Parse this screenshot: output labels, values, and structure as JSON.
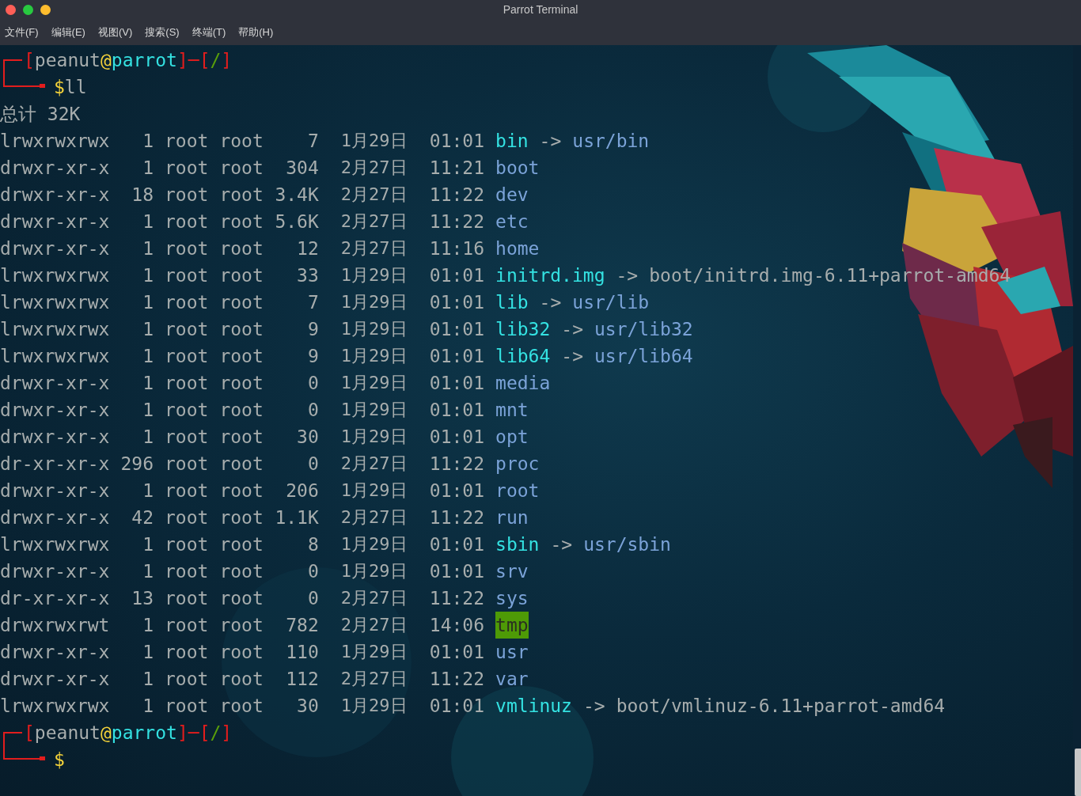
{
  "window": {
    "title": "Parrot Terminal"
  },
  "menu": [
    "文件(F)",
    "编辑(E)",
    "视图(V)",
    "搜索(S)",
    "终端(T)",
    "帮助(H)"
  ],
  "terminal": {
    "blocks": [
      {
        "kind": "prompt",
        "segments": [
          {
            "text": "[",
            "kind": "bracket"
          },
          {
            "text": "peanut",
            "kind": "user"
          },
          {
            "text": "@",
            "kind": "at"
          },
          {
            "text": "parrot",
            "kind": "host"
          },
          {
            "text": "]",
            "kind": "bracket"
          },
          {
            "text": "─",
            "kind": "bracket"
          },
          {
            "text": "[",
            "kind": "bracket"
          },
          {
            "text": "/",
            "kind": "path"
          },
          {
            "text": "]",
            "kind": "bracket"
          }
        ],
        "symbol": "$",
        "command": "ll"
      },
      {
        "kind": "total",
        "text": "总计 32K"
      },
      {
        "kind": "entry",
        "perms": "lrwxrwxrwx",
        "links": "1",
        "owner": "root",
        "group": "root",
        "size": "7",
        "date": "1月29日",
        "time": "01:01",
        "name": {
          "text": "bin",
          "kind": "link"
        },
        "arrow": "->",
        "target": {
          "text": "usr/bin",
          "kind": "dir"
        }
      },
      {
        "kind": "entry",
        "perms": "drwxr-xr-x",
        "links": "1",
        "owner": "root",
        "group": "root",
        "size": "304",
        "date": "2月27日",
        "time": "11:21",
        "name": {
          "text": "boot",
          "kind": "dir"
        }
      },
      {
        "kind": "entry",
        "perms": "drwxr-xr-x",
        "links": "18",
        "owner": "root",
        "group": "root",
        "size": "3.4K",
        "date": "2月27日",
        "time": "11:22",
        "name": {
          "text": "dev",
          "kind": "dir"
        }
      },
      {
        "kind": "entry",
        "perms": "drwxr-xr-x",
        "links": "1",
        "owner": "root",
        "group": "root",
        "size": "5.6K",
        "date": "2月27日",
        "time": "11:22",
        "name": {
          "text": "etc",
          "kind": "dir"
        }
      },
      {
        "kind": "entry",
        "perms": "drwxr-xr-x",
        "links": "1",
        "owner": "root",
        "group": "root",
        "size": "12",
        "date": "2月27日",
        "time": "11:16",
        "name": {
          "text": "home",
          "kind": "dir"
        }
      },
      {
        "kind": "entry",
        "perms": "lrwxrwxrwx",
        "links": "1",
        "owner": "root",
        "group": "root",
        "size": "33",
        "date": "1月29日",
        "time": "01:01",
        "name": {
          "text": "initrd.img",
          "kind": "link"
        },
        "arrow": "->",
        "target": {
          "text": "boot/initrd.img-6.11+parrot-amd64",
          "kind": "file"
        }
      },
      {
        "kind": "entry",
        "perms": "lrwxrwxrwx",
        "links": "1",
        "owner": "root",
        "group": "root",
        "size": "7",
        "date": "1月29日",
        "time": "01:01",
        "name": {
          "text": "lib",
          "kind": "link"
        },
        "arrow": "->",
        "target": {
          "text": "usr/lib",
          "kind": "dir"
        }
      },
      {
        "kind": "entry",
        "perms": "lrwxrwxrwx",
        "links": "1",
        "owner": "root",
        "group": "root",
        "size": "9",
        "date": "1月29日",
        "time": "01:01",
        "name": {
          "text": "lib32",
          "kind": "link"
        },
        "arrow": "->",
        "target": {
          "text": "usr/lib32",
          "kind": "dir"
        }
      },
      {
        "kind": "entry",
        "perms": "lrwxrwxrwx",
        "links": "1",
        "owner": "root",
        "group": "root",
        "size": "9",
        "date": "1月29日",
        "time": "01:01",
        "name": {
          "text": "lib64",
          "kind": "link"
        },
        "arrow": "->",
        "target": {
          "text": "usr/lib64",
          "kind": "dir"
        }
      },
      {
        "kind": "entry",
        "perms": "drwxr-xr-x",
        "links": "1",
        "owner": "root",
        "group": "root",
        "size": "0",
        "date": "1月29日",
        "time": "01:01",
        "name": {
          "text": "media",
          "kind": "dir"
        }
      },
      {
        "kind": "entry",
        "perms": "drwxr-xr-x",
        "links": "1",
        "owner": "root",
        "group": "root",
        "size": "0",
        "date": "1月29日",
        "time": "01:01",
        "name": {
          "text": "mnt",
          "kind": "dir"
        }
      },
      {
        "kind": "entry",
        "perms": "drwxr-xr-x",
        "links": "1",
        "owner": "root",
        "group": "root",
        "size": "30",
        "date": "1月29日",
        "time": "01:01",
        "name": {
          "text": "opt",
          "kind": "dir"
        }
      },
      {
        "kind": "entry",
        "perms": "dr-xr-xr-x",
        "links": "296",
        "owner": "root",
        "group": "root",
        "size": "0",
        "date": "2月27日",
        "time": "11:22",
        "name": {
          "text": "proc",
          "kind": "dir"
        }
      },
      {
        "kind": "entry",
        "perms": "drwxr-xr-x",
        "links": "1",
        "owner": "root",
        "group": "root",
        "size": "206",
        "date": "1月29日",
        "time": "01:01",
        "name": {
          "text": "root",
          "kind": "dir"
        }
      },
      {
        "kind": "entry",
        "perms": "drwxr-xr-x",
        "links": "42",
        "owner": "root",
        "group": "root",
        "size": "1.1K",
        "date": "2月27日",
        "time": "11:22",
        "name": {
          "text": "run",
          "kind": "dir"
        }
      },
      {
        "kind": "entry",
        "perms": "lrwxrwxrwx",
        "links": "1",
        "owner": "root",
        "group": "root",
        "size": "8",
        "date": "1月29日",
        "time": "01:01",
        "name": {
          "text": "sbin",
          "kind": "link"
        },
        "arrow": "->",
        "target": {
          "text": "usr/sbin",
          "kind": "dir"
        }
      },
      {
        "kind": "entry",
        "perms": "drwxr-xr-x",
        "links": "1",
        "owner": "root",
        "group": "root",
        "size": "0",
        "date": "1月29日",
        "time": "01:01",
        "name": {
          "text": "srv",
          "kind": "dir"
        }
      },
      {
        "kind": "entry",
        "perms": "dr-xr-xr-x",
        "links": "13",
        "owner": "root",
        "group": "root",
        "size": "0",
        "date": "2月27日",
        "time": "11:22",
        "name": {
          "text": "sys",
          "kind": "dir"
        }
      },
      {
        "kind": "entry",
        "perms": "drwxrwxrwt",
        "links": "1",
        "owner": "root",
        "group": "root",
        "size": "782",
        "date": "2月27日",
        "time": "14:06",
        "name": {
          "text": "tmp",
          "kind": "sticky"
        }
      },
      {
        "kind": "entry",
        "perms": "drwxr-xr-x",
        "links": "1",
        "owner": "root",
        "group": "root",
        "size": "110",
        "date": "1月29日",
        "time": "01:01",
        "name": {
          "text": "usr",
          "kind": "dir"
        }
      },
      {
        "kind": "entry",
        "perms": "drwxr-xr-x",
        "links": "1",
        "owner": "root",
        "group": "root",
        "size": "112",
        "date": "2月27日",
        "time": "11:22",
        "name": {
          "text": "var",
          "kind": "dir"
        }
      },
      {
        "kind": "entry",
        "perms": "lrwxrwxrwx",
        "links": "1",
        "owner": "root",
        "group": "root",
        "size": "30",
        "date": "1月29日",
        "time": "01:01",
        "name": {
          "text": "vmlinuz",
          "kind": "link"
        },
        "arrow": "->",
        "target": {
          "text": "boot/vmlinuz-6.11+parrot-amd64",
          "kind": "file"
        }
      },
      {
        "kind": "prompt",
        "segments": [
          {
            "text": "[",
            "kind": "bracket"
          },
          {
            "text": "peanut",
            "kind": "user"
          },
          {
            "text": "@",
            "kind": "at"
          },
          {
            "text": "parrot",
            "kind": "host"
          },
          {
            "text": "]",
            "kind": "bracket"
          },
          {
            "text": "─",
            "kind": "bracket"
          },
          {
            "text": "[",
            "kind": "bracket"
          },
          {
            "text": "/",
            "kind": "path"
          },
          {
            "text": "]",
            "kind": "bracket"
          }
        ],
        "symbol": "$"
      }
    ]
  }
}
